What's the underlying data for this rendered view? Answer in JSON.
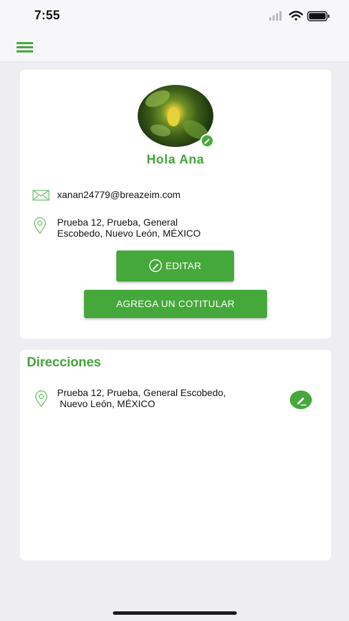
{
  "status_bar": {
    "time": "7:55"
  },
  "colors": {
    "accent": "#43a33a",
    "button": "#45a83a",
    "background": "#eeeef2"
  },
  "nav": {
    "menu_icon": "hamburger-menu-icon"
  },
  "profile": {
    "greeting": "Hola  Ana",
    "email": "xanan24779@breazeim.com",
    "address_line1": "Prueba 12,  Prueba, General",
    "address_line2": "Escobedo, Nuevo León, MÉXICO",
    "edit_button": "EDITAR",
    "add_cotitular_button": "AGREGA UN COTITULAR"
  },
  "addresses": {
    "title": "Direcciones",
    "items": [
      {
        "line1": "Prueba 12, Prueba, General Escobedo,",
        "line2": " Nuevo León, MÉXICO"
      }
    ]
  }
}
